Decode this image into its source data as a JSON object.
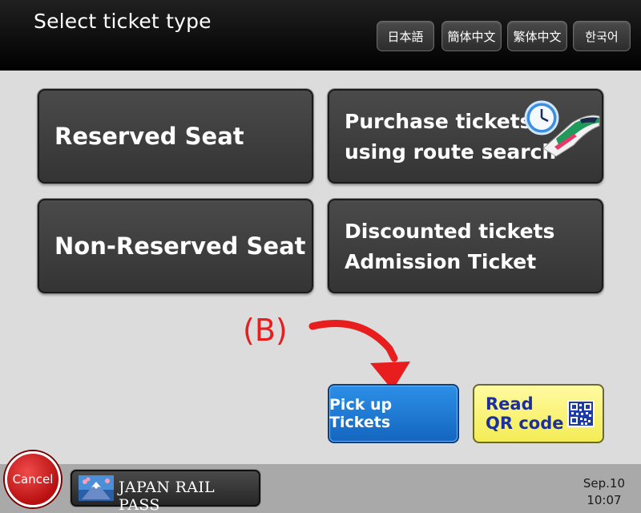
{
  "header": {
    "title": "Select ticket type",
    "languages": [
      "日本語",
      "簡体中文",
      "繁体中文",
      "한국어"
    ]
  },
  "tiles": {
    "reserved": "Reserved Seat",
    "route_search": [
      "Purchase tickets",
      "using route search"
    ],
    "non_reserved": "Non-Reserved Seat",
    "discounted": [
      "Discounted tickets",
      "Admission Ticket"
    ]
  },
  "annotation": {
    "label": "(B)",
    "color": "#e81e1e"
  },
  "actions": {
    "pickup": "Pick up Tickets",
    "read_qr": [
      "Read",
      "QR code"
    ]
  },
  "footer": {
    "cancel": "Cancel",
    "jr_pass": "JAPAN RAIL PASS",
    "date": "Sep.10",
    "time": "10:07"
  },
  "colors": {
    "pickup_blue": "#1e7bd6",
    "qr_yellow": "#f8f27a",
    "cancel_red": "#d42020"
  },
  "icons": [
    "clock-icon",
    "shinkansen-icon",
    "qr-code-icon",
    "mount-fuji-icon"
  ]
}
